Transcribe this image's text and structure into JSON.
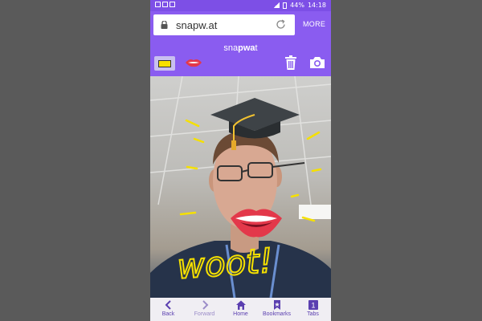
{
  "status_bar": {
    "battery": "44%",
    "time": "14:18"
  },
  "browser": {
    "url": "snapw.at",
    "more_label": "MORE"
  },
  "app": {
    "title_prefix": "sna",
    "title_bold": "pwa",
    "title_suffix": "t",
    "colors": {
      "swatch": "#f7e000",
      "accent": "#8a5cf0"
    }
  },
  "photo": {
    "doodle_text": "woot!"
  },
  "nav": {
    "items": [
      {
        "label": "Back",
        "icon": "back-icon"
      },
      {
        "label": "Forward",
        "icon": "forward-icon"
      },
      {
        "label": "Home",
        "icon": "home-icon"
      },
      {
        "label": "Bookmarks",
        "icon": "bookmark-icon"
      },
      {
        "label": "Tabs",
        "icon": "tabs-icon",
        "badge": "1"
      }
    ]
  }
}
